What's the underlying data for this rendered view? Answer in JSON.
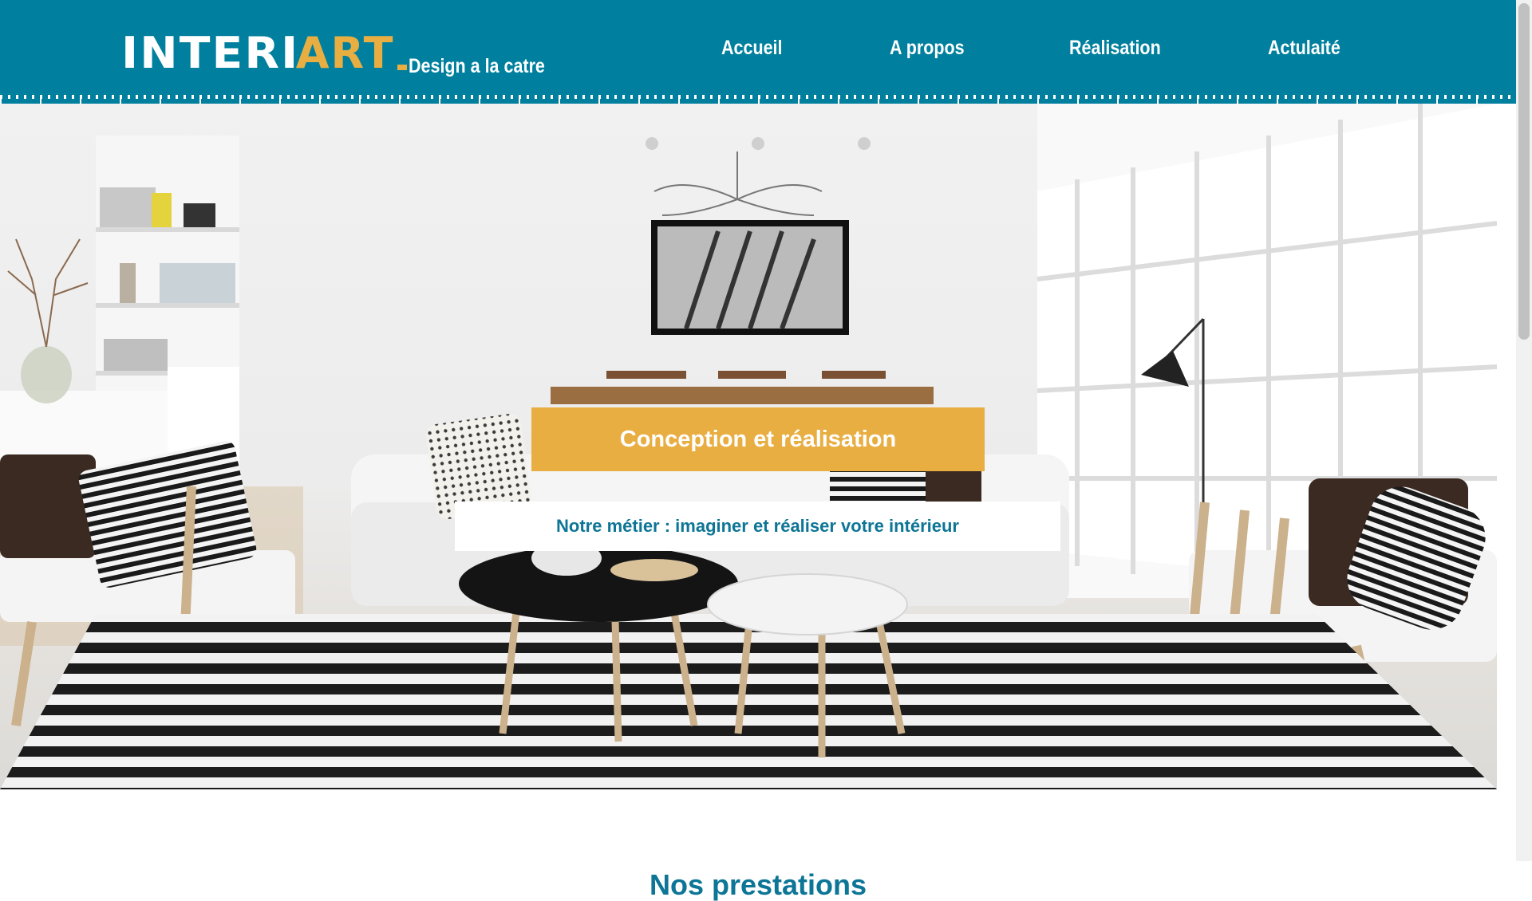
{
  "header": {
    "logo": {
      "part1": "INTERI",
      "part2": "ART",
      "tagline": "Design a la catre"
    },
    "nav": [
      {
        "label": "Accueil"
      },
      {
        "label": "A propos"
      },
      {
        "label": "Réalisation"
      },
      {
        "label": "Actulaité"
      }
    ]
  },
  "hero": {
    "title": "Conception et réalisation",
    "subtitle": "Notre métier : imaginer et réaliser votre intérieur"
  },
  "section": {
    "title": "Nos prestations"
  },
  "colors": {
    "header_bg": "#00809e",
    "accent": "#e8ae42",
    "text_teal": "#0d7596"
  },
  "icons": {
    "logo_dot": "logo-dot-icon"
  }
}
